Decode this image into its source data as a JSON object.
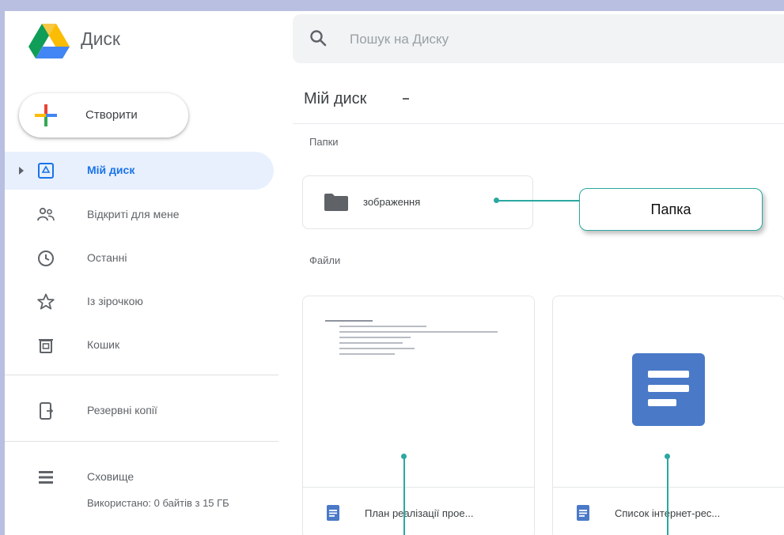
{
  "app": {
    "name": "Диск"
  },
  "search": {
    "placeholder": "Пошук на Диску"
  },
  "sidebar": {
    "create_label": "Створити",
    "items": [
      {
        "label": "Мій диск",
        "icon": "my-drive-icon",
        "active": true
      },
      {
        "label": "Відкриті для мене",
        "icon": "shared-users-icon"
      },
      {
        "label": "Останні",
        "icon": "clock-icon"
      },
      {
        "label": "Із зірочкою",
        "icon": "star-icon"
      },
      {
        "label": "Кошик",
        "icon": "trash-icon"
      }
    ],
    "backups": {
      "label": "Резервні копії",
      "icon": "backup-icon"
    },
    "storage": {
      "label": "Сховище",
      "icon": "storage-icon",
      "usage": "Використано: 0 байтів з 15 ГБ"
    }
  },
  "main": {
    "title": "Мій диск",
    "folders_label": "Папки",
    "files_label": "Файли",
    "folders": [
      {
        "name": "зображення",
        "icon": "folder-icon"
      }
    ],
    "files": [
      {
        "name": "План реалізації прое...",
        "icon": "doc-icon"
      },
      {
        "name": "Список інтернет-рес...",
        "icon": "doc-icon"
      }
    ]
  },
  "callouts": [
    {
      "label": "Папка"
    }
  ],
  "colors": {
    "accent": "#1a73e8",
    "callout": "#2ba8a0",
    "doc_blue": "#4a79c8"
  }
}
